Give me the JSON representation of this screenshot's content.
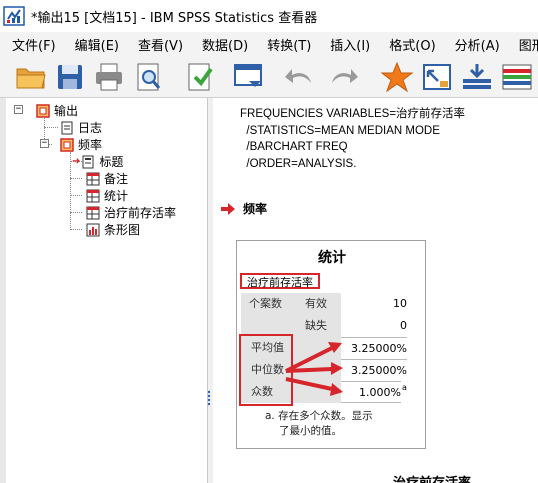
{
  "window": {
    "title": "*输出15 [文档15] - IBM SPSS Statistics 查看器"
  },
  "menu": [
    {
      "label": "文件(F)"
    },
    {
      "label": "编辑(E)"
    },
    {
      "label": "查看(V)"
    },
    {
      "label": "数据(D)"
    },
    {
      "label": "转换(T)"
    },
    {
      "label": "插入(I)"
    },
    {
      "label": "格式(O)"
    },
    {
      "label": "分析(A)"
    },
    {
      "label": "图形(G"
    }
  ],
  "toolbar": {
    "icons": [
      "open-folder-icon",
      "save-icon",
      "print-icon",
      "print-preview-icon",
      "export-icon",
      "goto-data-icon",
      "undo-icon",
      "redo-icon",
      "star-icon",
      "goto-case-icon",
      "weight-cases-icon",
      "split-file-icon"
    ]
  },
  "tree": {
    "output": "输出",
    "log": "日志",
    "frequencies": "频率",
    "items": [
      "标题",
      "备注",
      "统计",
      "治疗前存活率",
      "条形图"
    ]
  },
  "syntax": {
    "lines": [
      "FREQUENCIES VARIABLES=治疗前存活率",
      "  /STATISTICS=MEAN MEDIAN MODE",
      "  /BARCHART FREQ",
      "  /ORDER=ANALYSIS."
    ]
  },
  "section": {
    "title": "频率"
  },
  "stats_table": {
    "title": "统计",
    "variable": "治疗前存活率",
    "n_label": "个案数",
    "valid_label": "有效",
    "missing_label": "缺失",
    "valid_value": "10",
    "missing_value": "0",
    "mean_label": "平均值",
    "median_label": "中位数",
    "mode_label": "众数",
    "mean_value": "3.25000%",
    "median_value": "3.25000%",
    "mode_value": "1.000%",
    "mode_superscript": "a",
    "footnote_line1": "a. 存在多个众数。显示",
    "footnote_line2": "了最小的值。"
  },
  "next_chart_title": "治疗前存活率",
  "colors": {
    "highlight_red": "#d6262b",
    "row_header_grey": "#e4e4e4",
    "toolbar_bg": "#f3f3f3"
  }
}
